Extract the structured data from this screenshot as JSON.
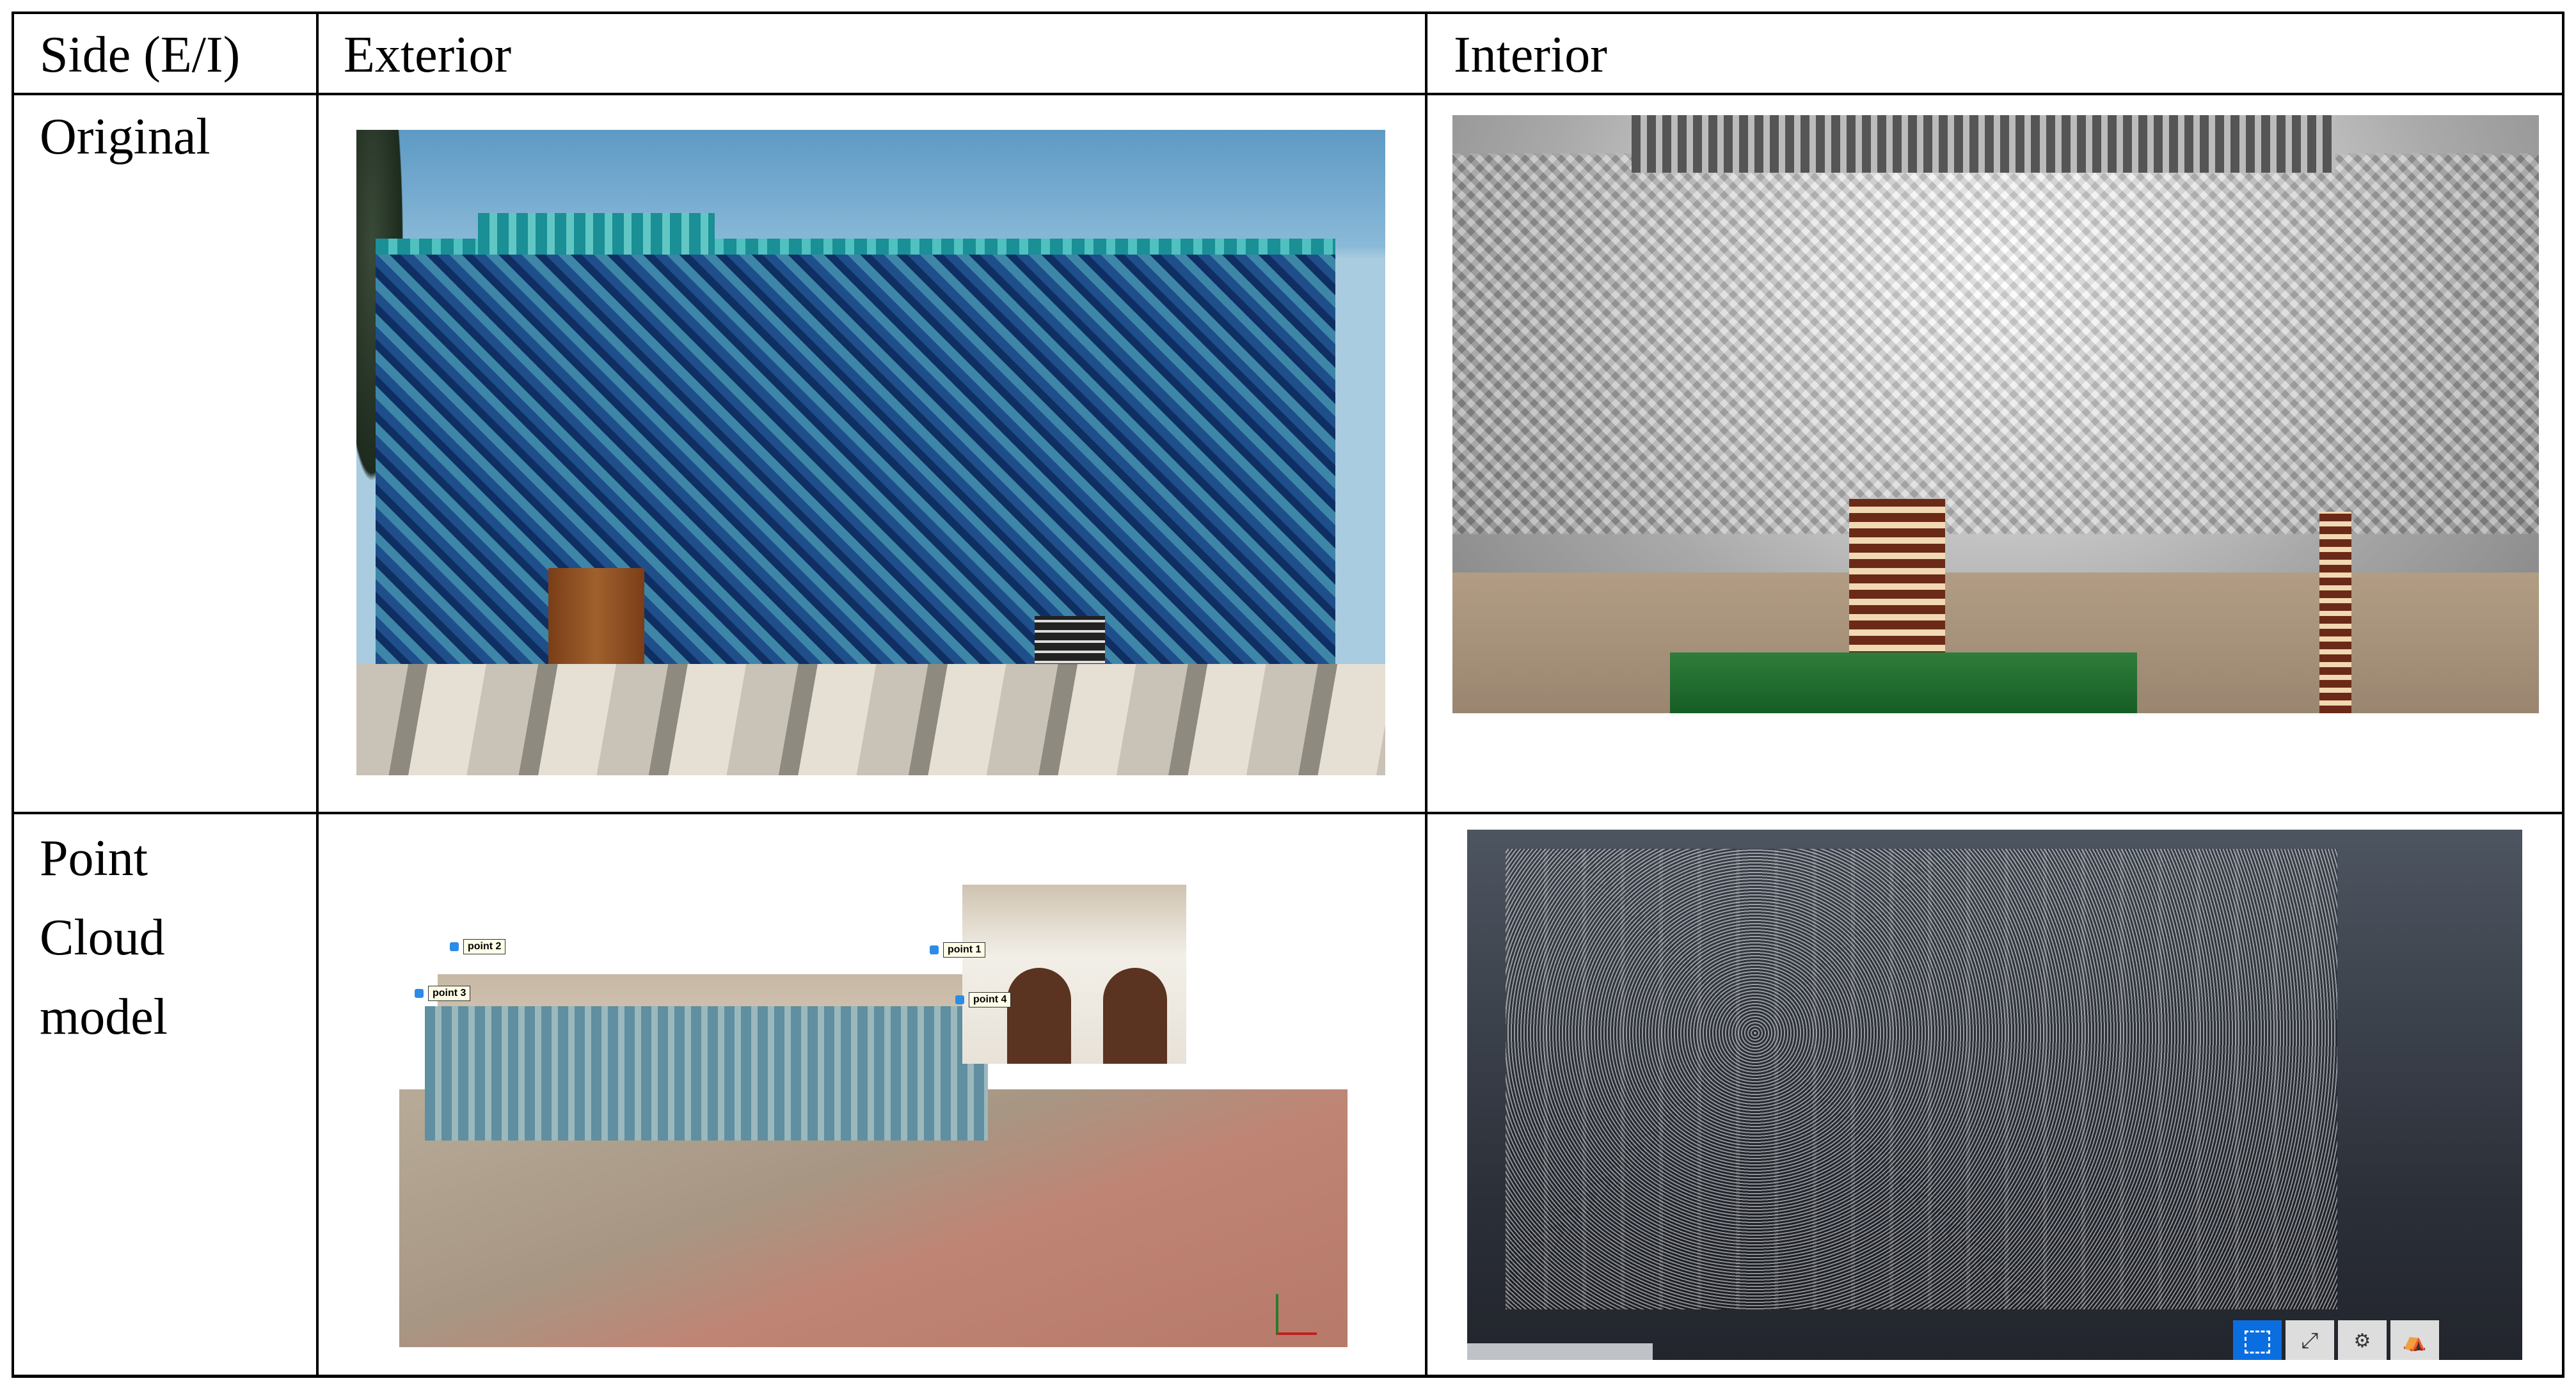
{
  "table": {
    "headers": [
      "Side (E/I)",
      "Exterior",
      "Interior"
    ],
    "rows": [
      {
        "label": "Original",
        "exterior_image": "exterior-original-photo",
        "interior_image": "interior-original-photo"
      },
      {
        "label_lines": [
          "Point",
          "Cloud",
          "model"
        ],
        "exterior_image": "exterior-point-cloud-render",
        "interior_image": "interior-point-cloud-render"
      }
    ]
  },
  "point_cloud_exterior": {
    "point_labels": [
      "point 1",
      "point 2",
      "point 3",
      "point 4"
    ]
  },
  "colors": {
    "border": "#000000",
    "active_tool": "#0b6ee0"
  }
}
